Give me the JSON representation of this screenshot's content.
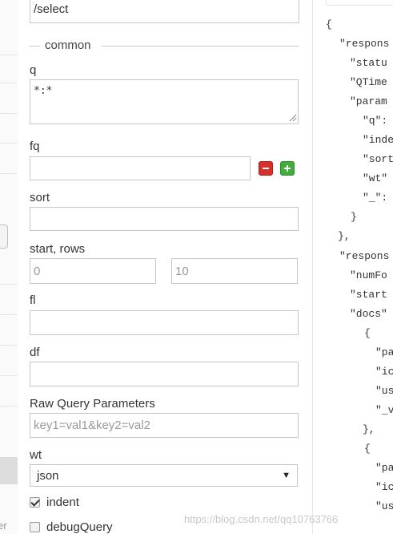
{
  "form": {
    "handler_value": "/select",
    "section_title": "common",
    "q": {
      "label": "q",
      "value": "*:*"
    },
    "fq": {
      "label": "fq",
      "value": ""
    },
    "sort": {
      "label": "sort",
      "value": ""
    },
    "start_rows": {
      "label": "start, rows",
      "start_placeholder": "0",
      "rows_placeholder": "10"
    },
    "fl": {
      "label": "fl",
      "value": ""
    },
    "df": {
      "label": "df",
      "value": ""
    },
    "raw": {
      "label": "Raw Query Parameters",
      "placeholder": "key1=val1&key2=val2"
    },
    "wt": {
      "label": "wt",
      "selected": "json"
    },
    "indent": {
      "label": "indent",
      "checked": true
    },
    "debug": {
      "label": "debugQuery",
      "checked": false
    }
  },
  "sidebar": {
    "partial_text": "er"
  },
  "response_lines": [
    "{",
    "\"respons",
    "\"statu",
    "\"QTime",
    "\"param",
    "\"q\":",
    "\"inde",
    "\"sort",
    "\"wt\"",
    "\"_\":",
    "}",
    "},",
    "\"respons",
    "\"numFo",
    "\"start",
    "\"docs\"",
    "{",
    "\"pa",
    "\"ic",
    "\"us",
    "\"_v",
    "},",
    "{",
    "\"pa",
    "\"ic",
    "\"us"
  ],
  "watermark": "https://blog.csdn.net/qq10763766"
}
